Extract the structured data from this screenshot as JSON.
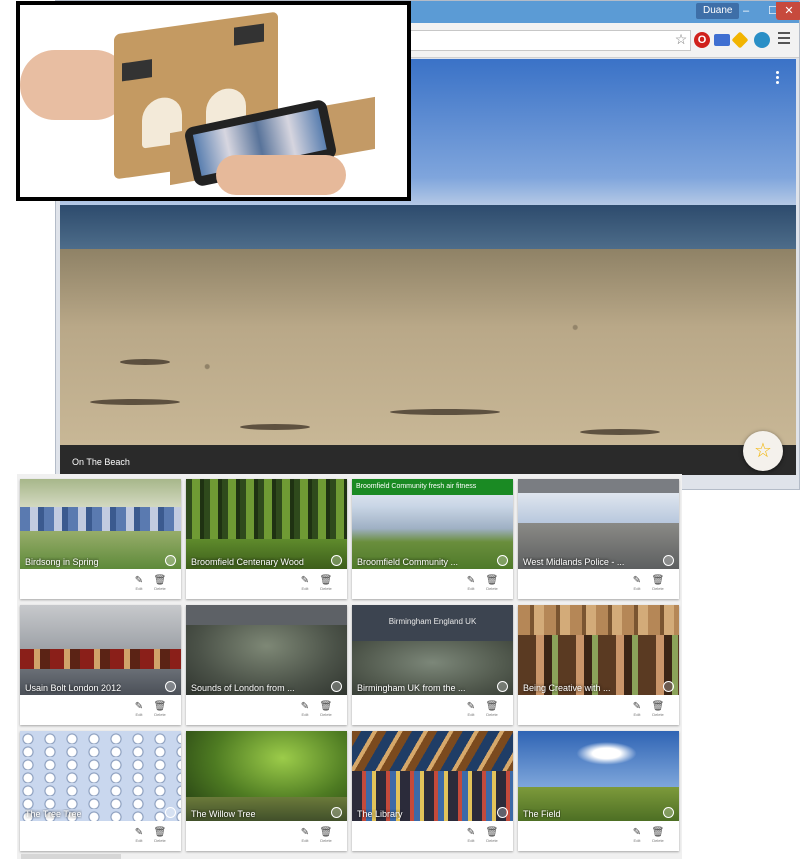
{
  "browser": {
    "user_badge": "Duane",
    "window_controls": {
      "minimize": "–",
      "maximize": "☐",
      "close": "✕"
    },
    "toolbar_icons": [
      "star-icon",
      "opera-icon",
      "mail-icon",
      "drive-icon",
      "sync-icon",
      "menu-icon"
    ]
  },
  "viewer": {
    "caption": "On The Beach",
    "fab_icon": "☆"
  },
  "gallery": {
    "cards": [
      {
        "title": "Birdsong in Spring",
        "edit": "Edit",
        "delete": "Delete",
        "banner": ""
      },
      {
        "title": "Broomfield Centenary Wood",
        "edit": "Edit",
        "delete": "Delete",
        "banner": ""
      },
      {
        "title": "Broomfield Community ...",
        "edit": "Edit",
        "delete": "Delete",
        "banner": "Broomfield Community fresh air fitness"
      },
      {
        "title": "West Midlands Police - ...",
        "edit": "Edit",
        "delete": "Delete",
        "banner": ""
      },
      {
        "title": "Usain Bolt London 2012",
        "edit": "Edit",
        "delete": "Delete",
        "banner": ""
      },
      {
        "title": "Sounds of London from ...",
        "edit": "Edit",
        "delete": "Delete",
        "banner": ""
      },
      {
        "title": "Birmingham UK from the ...",
        "edit": "Edit",
        "delete": "Delete",
        "banner": "Birmingham England UK"
      },
      {
        "title": "Being Creative with ...",
        "edit": "Edit",
        "delete": "Delete",
        "banner": ""
      },
      {
        "title": "The Tree Tree",
        "edit": "Edit",
        "delete": "Delete",
        "banner": ""
      },
      {
        "title": "The Willow Tree",
        "edit": "Edit",
        "delete": "Delete",
        "banner": ""
      },
      {
        "title": "The Library",
        "edit": "Edit",
        "delete": "Delete",
        "banner": ""
      },
      {
        "title": "The Field",
        "edit": "Edit",
        "delete": "Delete",
        "banner": ""
      }
    ],
    "edit_glyph": "✎",
    "delete_glyph": "🗑"
  },
  "colors": {
    "titlebar": "#5b9bd5",
    "fab_star": "#f2b400",
    "close_button": "#c74a3d"
  }
}
